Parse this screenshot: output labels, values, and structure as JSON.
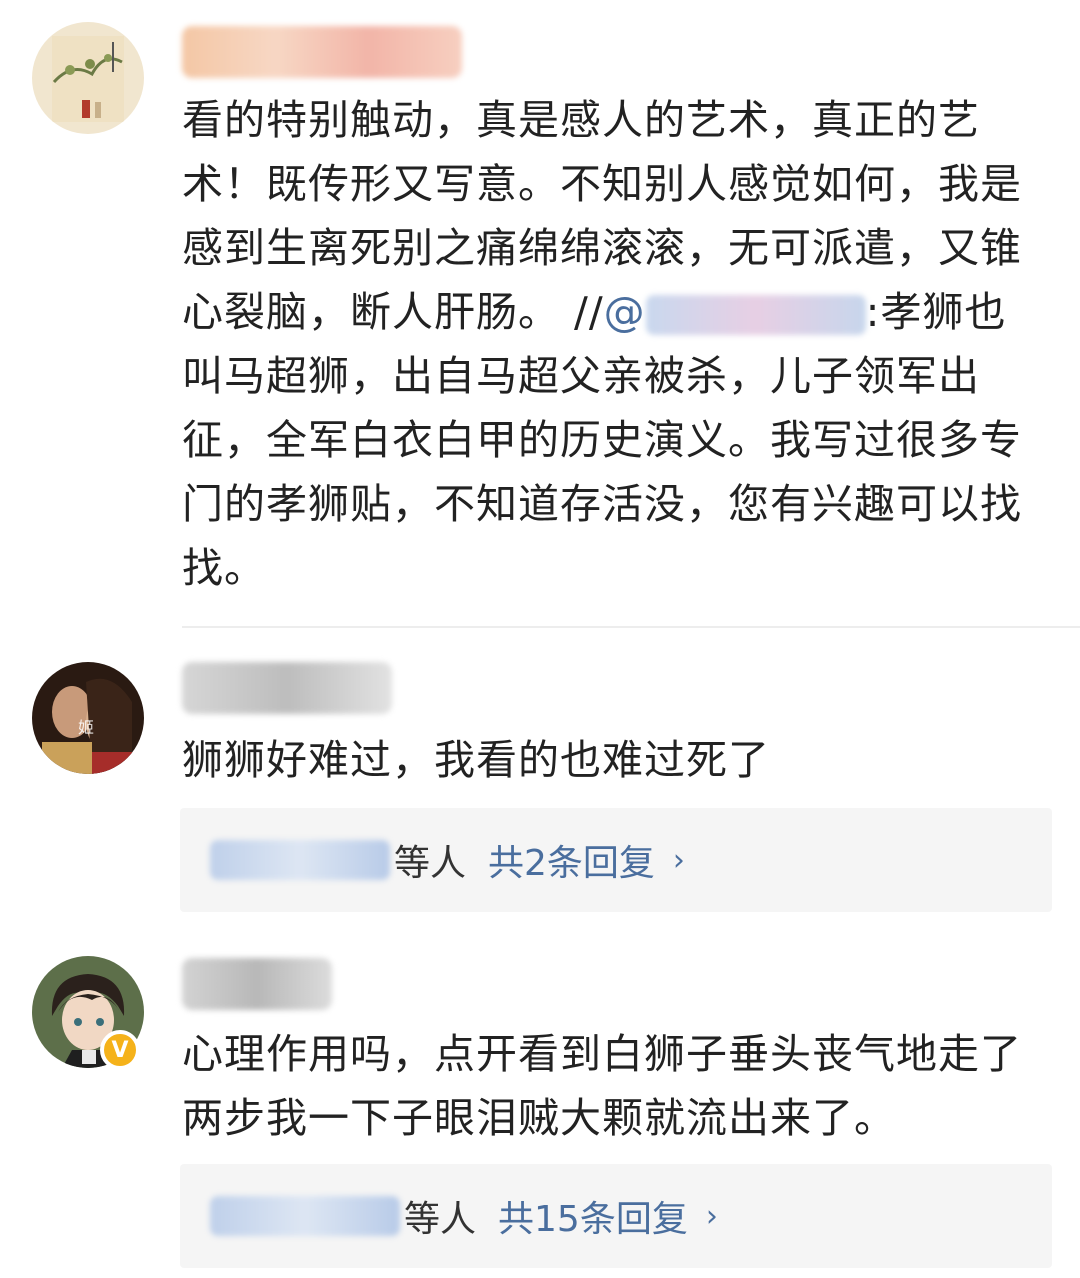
{
  "comments": [
    {
      "text_line1": "看的特别触动，真是感人的艺术，真正的艺术！既传形又写意。不知别人感觉如何，我是感到生离死别之痛绵绵滚滚，无可派遣，又锥心裂脑，断人肝肠。 //",
      "mention_label": "@",
      "text_line2": ":孝狮也叫马超狮，出自马超父亲被杀，儿子领军出征，全军白衣白甲的历史演义。我写过很多专门的孝狮贴，不知道存活没，您有兴趣可以找找。"
    },
    {
      "text": "狮狮好难过，我看的也难过死了",
      "avatar_char": "姬",
      "reply": {
        "suffix": "等人",
        "count_label": "共2条回复",
        "chevron": "›"
      }
    },
    {
      "text": "心理作用吗，点开看到白狮子垂头丧气地走了两步我一下子眼泪贼大颗就流出来了。",
      "badge": "V",
      "reply": {
        "suffix": "等人",
        "count_label": "共15条回复",
        "chevron": "›"
      }
    }
  ],
  "colors": {
    "link": "#4a6e9e",
    "reply_bg": "#f5f5f5",
    "badge": "#f5b21a"
  }
}
